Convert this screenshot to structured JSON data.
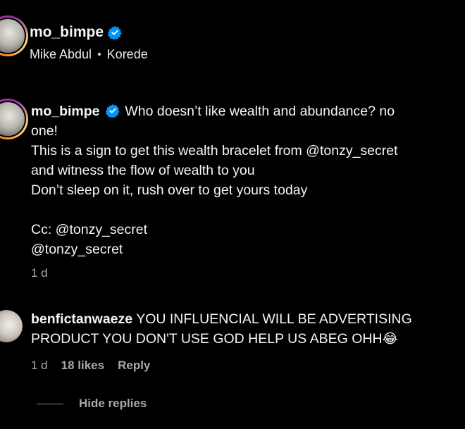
{
  "header": {
    "username": "mo_bimpe",
    "tagged": [
      "Mike Abdul",
      "Korede"
    ],
    "separator": "•"
  },
  "caption": {
    "username": "mo_bimpe",
    "line1_text": "Who doesn’t like wealth and abundance? no",
    "line2": "one!",
    "line3": "This is a sign to get this wealth bracelet from @tonzy_secret",
    "line4": "and witness the flow of wealth to you",
    "line5": "Don’t sleep on it, rush over to get yours today",
    "line6": "Cc: @tonzy_secret",
    "line7": "@tonzy_secret",
    "time": "1 d"
  },
  "comment": {
    "username": "benfictanwaeze",
    "line1_text": "YOU INFLUENCIAL WILL BE ADVERTISING",
    "line2_text": "PRODUCT YOU DON'T USE GOD HELP US ABEG OHH",
    "emoji": "😂",
    "time": "1 d",
    "likes": "18 likes",
    "reply_label": "Reply"
  },
  "replies_toggle": {
    "label": "Hide replies"
  },
  "colors": {
    "background": "#000000",
    "text_primary": "#f5f5f5",
    "text_secondary": "#a8a8a8",
    "verified_blue": "#0095f6"
  },
  "icons": {
    "verified": "verified-badge-icon"
  }
}
